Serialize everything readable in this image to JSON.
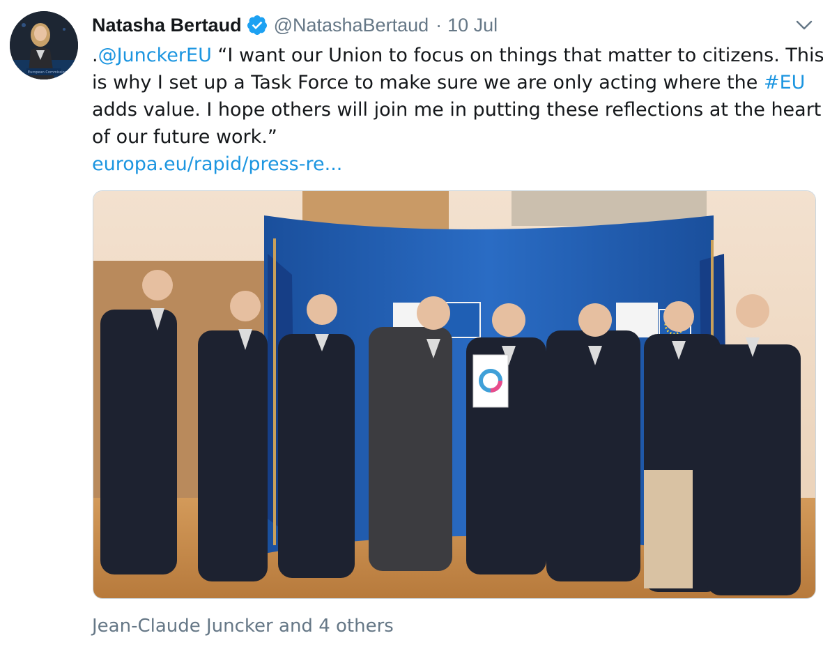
{
  "author": {
    "name": "Natasha Bertaud",
    "handle": "@NatashaBertaud",
    "separator": "·",
    "date": "10 Jul",
    "verified_icon": "verified-badge-icon",
    "verified_color": "#1da1f2"
  },
  "tweet": {
    "lines": [
      {
        "prefix": ".",
        "mention": "@JunckerEU",
        "text": " “I want our Union to focus on things that matter to citizens. This"
      },
      {
        "text_before": "is why I set up a Task Force to make sure we are only acting where the ",
        "hashtag": "#EU"
      },
      {
        "text": "adds value. I hope others will join me in putting these reflections at the heart"
      },
      {
        "text": "of our future work.”"
      }
    ],
    "link": "europa.eu/rapid/press-re..."
  },
  "media": {
    "type": "photo",
    "alt_icon": "photo-group-icon"
  },
  "tagged": "Jean-Claude Juncker and 4 others",
  "colors": {
    "link": "#1b95e0",
    "secondary_text": "#657786",
    "primary_text": "#14171a",
    "backdrop_blue": "#1f5fb4"
  },
  "icons": {
    "menu": "chevron-down-icon"
  }
}
